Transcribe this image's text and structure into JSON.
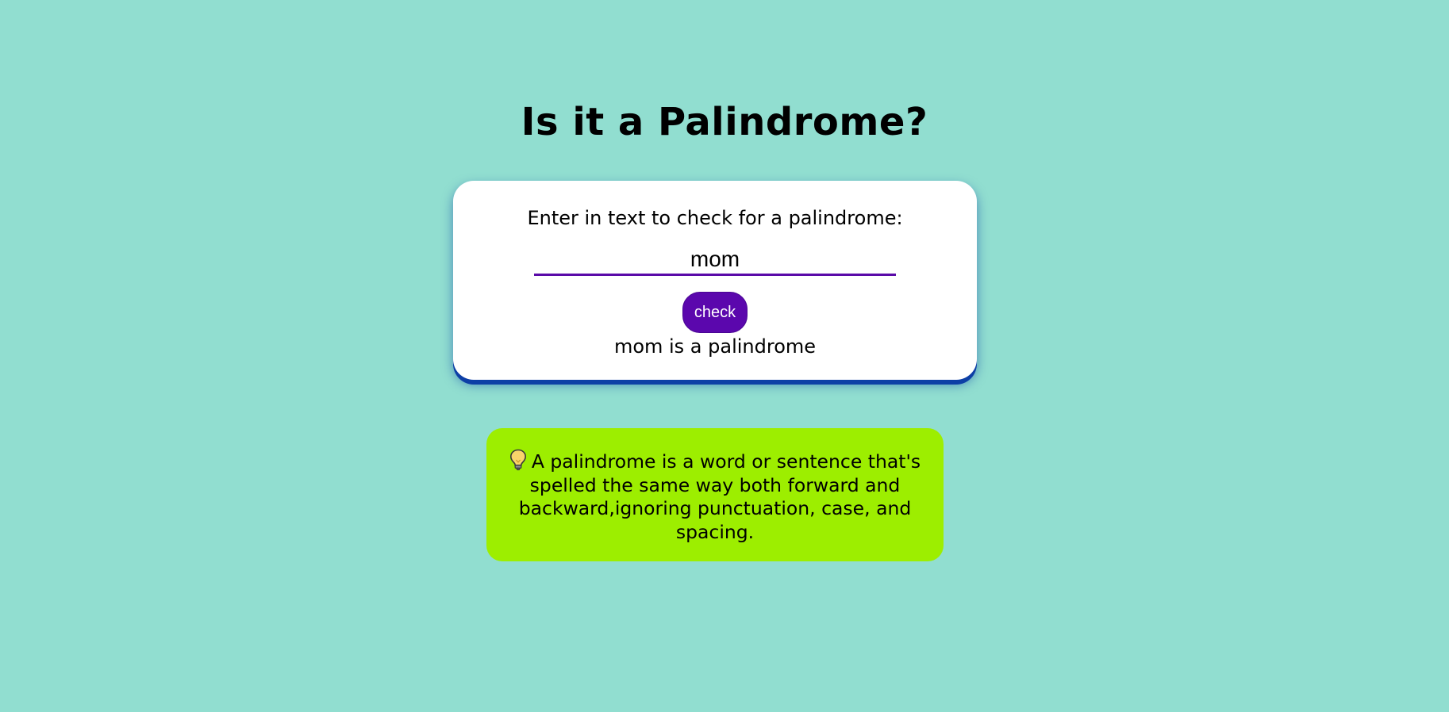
{
  "header": {
    "title": "Is it a Palindrome?"
  },
  "checker": {
    "label": "Enter in text to check for a palindrome:",
    "input_value": "mom",
    "button_label": "check",
    "result": "mom is a palindrome"
  },
  "info": {
    "icon": "lightbulb-icon",
    "text": "A palindrome is a word or sentence that's spelled the same way both forward and backward,ignoring punctuation, case, and spacing."
  },
  "colors": {
    "background": "#91ded0",
    "card": "#ffffff",
    "accent": "#5b07ad",
    "info_box": "#9dee00",
    "card_shadow": "#0d3fa6"
  }
}
